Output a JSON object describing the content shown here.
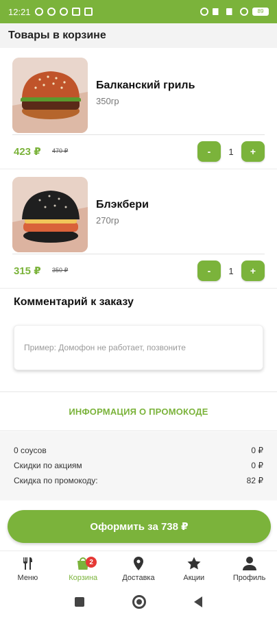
{
  "status_bar": {
    "time": "12:21",
    "battery": "89"
  },
  "header": {
    "title": "Товары в корзине"
  },
  "products": [
    {
      "name": "Балканский гриль",
      "weight": "350гр",
      "price": "423 ₽",
      "old_price": "470 ₽",
      "qty": "1",
      "minus": "-",
      "plus": "+",
      "image_icon": "burger-sesame-icon"
    },
    {
      "name": "Блэкбери",
      "weight": "270гр",
      "price": "315 ₽",
      "old_price": "350 ₽",
      "qty": "1",
      "minus": "-",
      "plus": "+",
      "image_icon": "burger-black-bun-icon"
    }
  ],
  "comment": {
    "title": "Комментарий к заказу",
    "placeholder": "Пример: Домофон не работает, позвоните",
    "value": ""
  },
  "promo": {
    "label": "ИНФОРМАЦИЯ О ПРОМОКОДЕ"
  },
  "summary": {
    "rows": [
      {
        "label": "0 соусов",
        "value": "0 ₽"
      },
      {
        "label": "Скидки по акциям",
        "value": "0 ₽"
      },
      {
        "label": "Скидка по промокоду:",
        "value": "82 ₽"
      }
    ]
  },
  "checkout": {
    "label": "Оформить за 738 ₽"
  },
  "bottom_nav": {
    "items": [
      {
        "label": "Меню",
        "icon": "fork-knife-icon"
      },
      {
        "label": "Корзина",
        "icon": "shopping-bag-icon",
        "badge": "2",
        "active": true
      },
      {
        "label": "Доставка",
        "icon": "map-pin-icon"
      },
      {
        "label": "Акции",
        "icon": "star-icon"
      },
      {
        "label": "Профиль",
        "icon": "user-icon"
      }
    ]
  },
  "colors": {
    "accent": "#7bb33b",
    "badge": "#e53935",
    "header_bg": "#f3f3f3"
  }
}
